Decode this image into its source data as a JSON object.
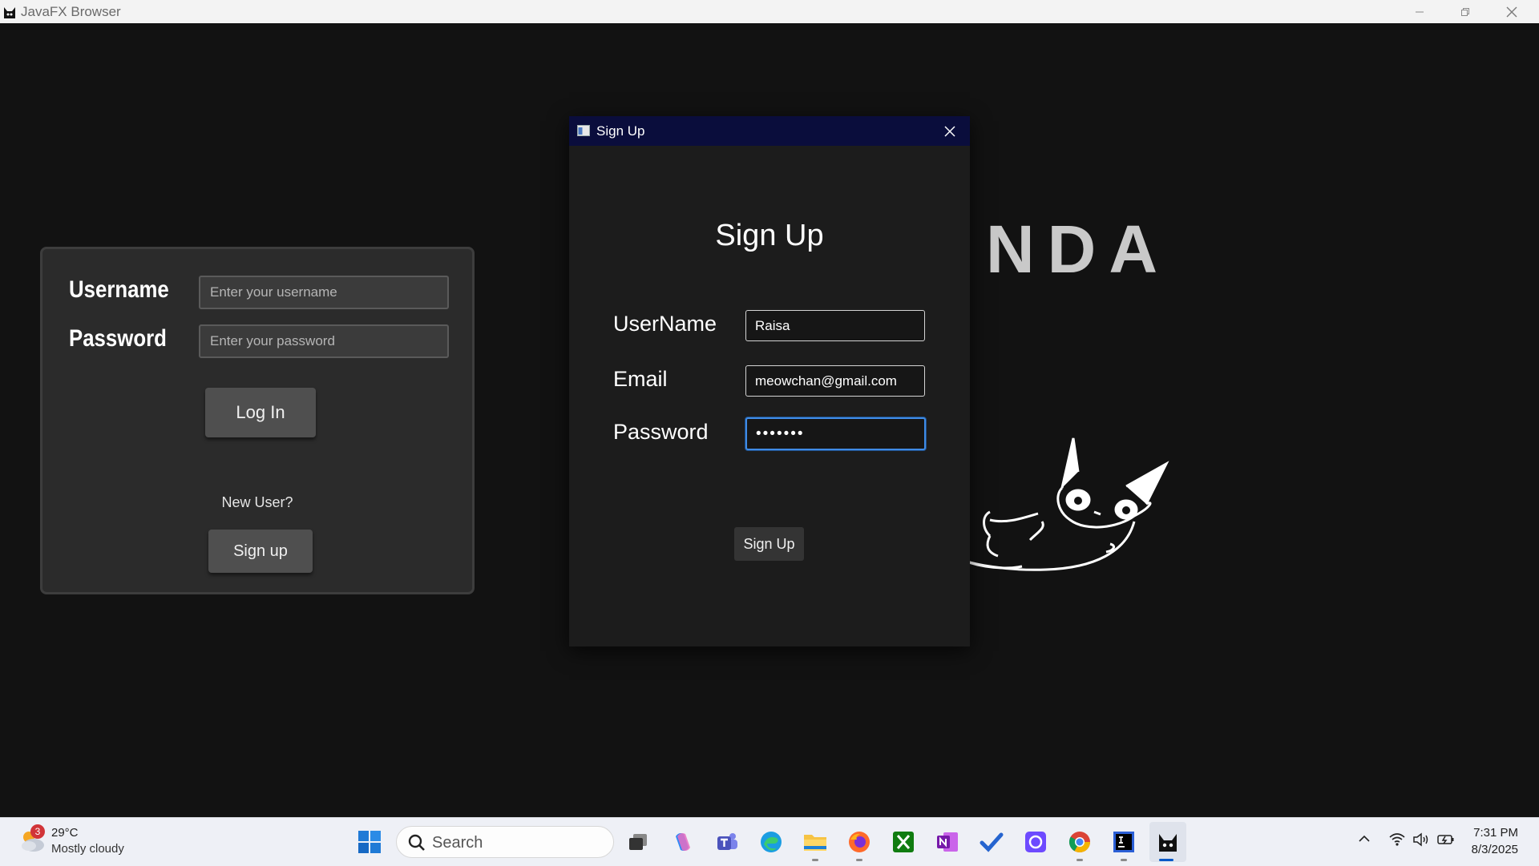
{
  "window": {
    "title": "JavaFX Browser",
    "buttons": {
      "minimize": "minimize",
      "maximize": "restore",
      "close": "close"
    }
  },
  "background_app": {
    "logo_text": "NDA",
    "login_panel": {
      "username_label": "Username",
      "password_label": "Password",
      "username_placeholder": "Enter your username",
      "password_placeholder": "Enter your password",
      "login_button": "Log In",
      "new_user_text": "New User?",
      "signup_button": "Sign up"
    }
  },
  "signup_dialog": {
    "title": "Sign Up",
    "heading": "Sign Up",
    "fields": {
      "username_label": "UserName",
      "username_value": "Raisa",
      "email_label": "Email",
      "email_value": "meowchan@gmail.com",
      "password_label": "Password",
      "password_value": "•••••••"
    },
    "submit_button": "Sign Up"
  },
  "taskbar": {
    "weather": {
      "badge": "3",
      "temperature": "29°C",
      "condition": "Mostly cloudy"
    },
    "search_placeholder": "Search",
    "apps": [
      "start",
      "task-view",
      "copilot",
      "teams",
      "edge",
      "file-explorer",
      "firefox",
      "xbox",
      "onenote",
      "todo",
      "proton",
      "chrome",
      "intellij",
      "javafx-browser"
    ],
    "clock": {
      "time": "7:31 PM",
      "date": "8/3/2025"
    }
  },
  "colors": {
    "background": "#121212",
    "dialog_titlebar": "#0a0d3c",
    "focus_accent": "#3f8be6",
    "taskbar": "#eef0f6"
  }
}
